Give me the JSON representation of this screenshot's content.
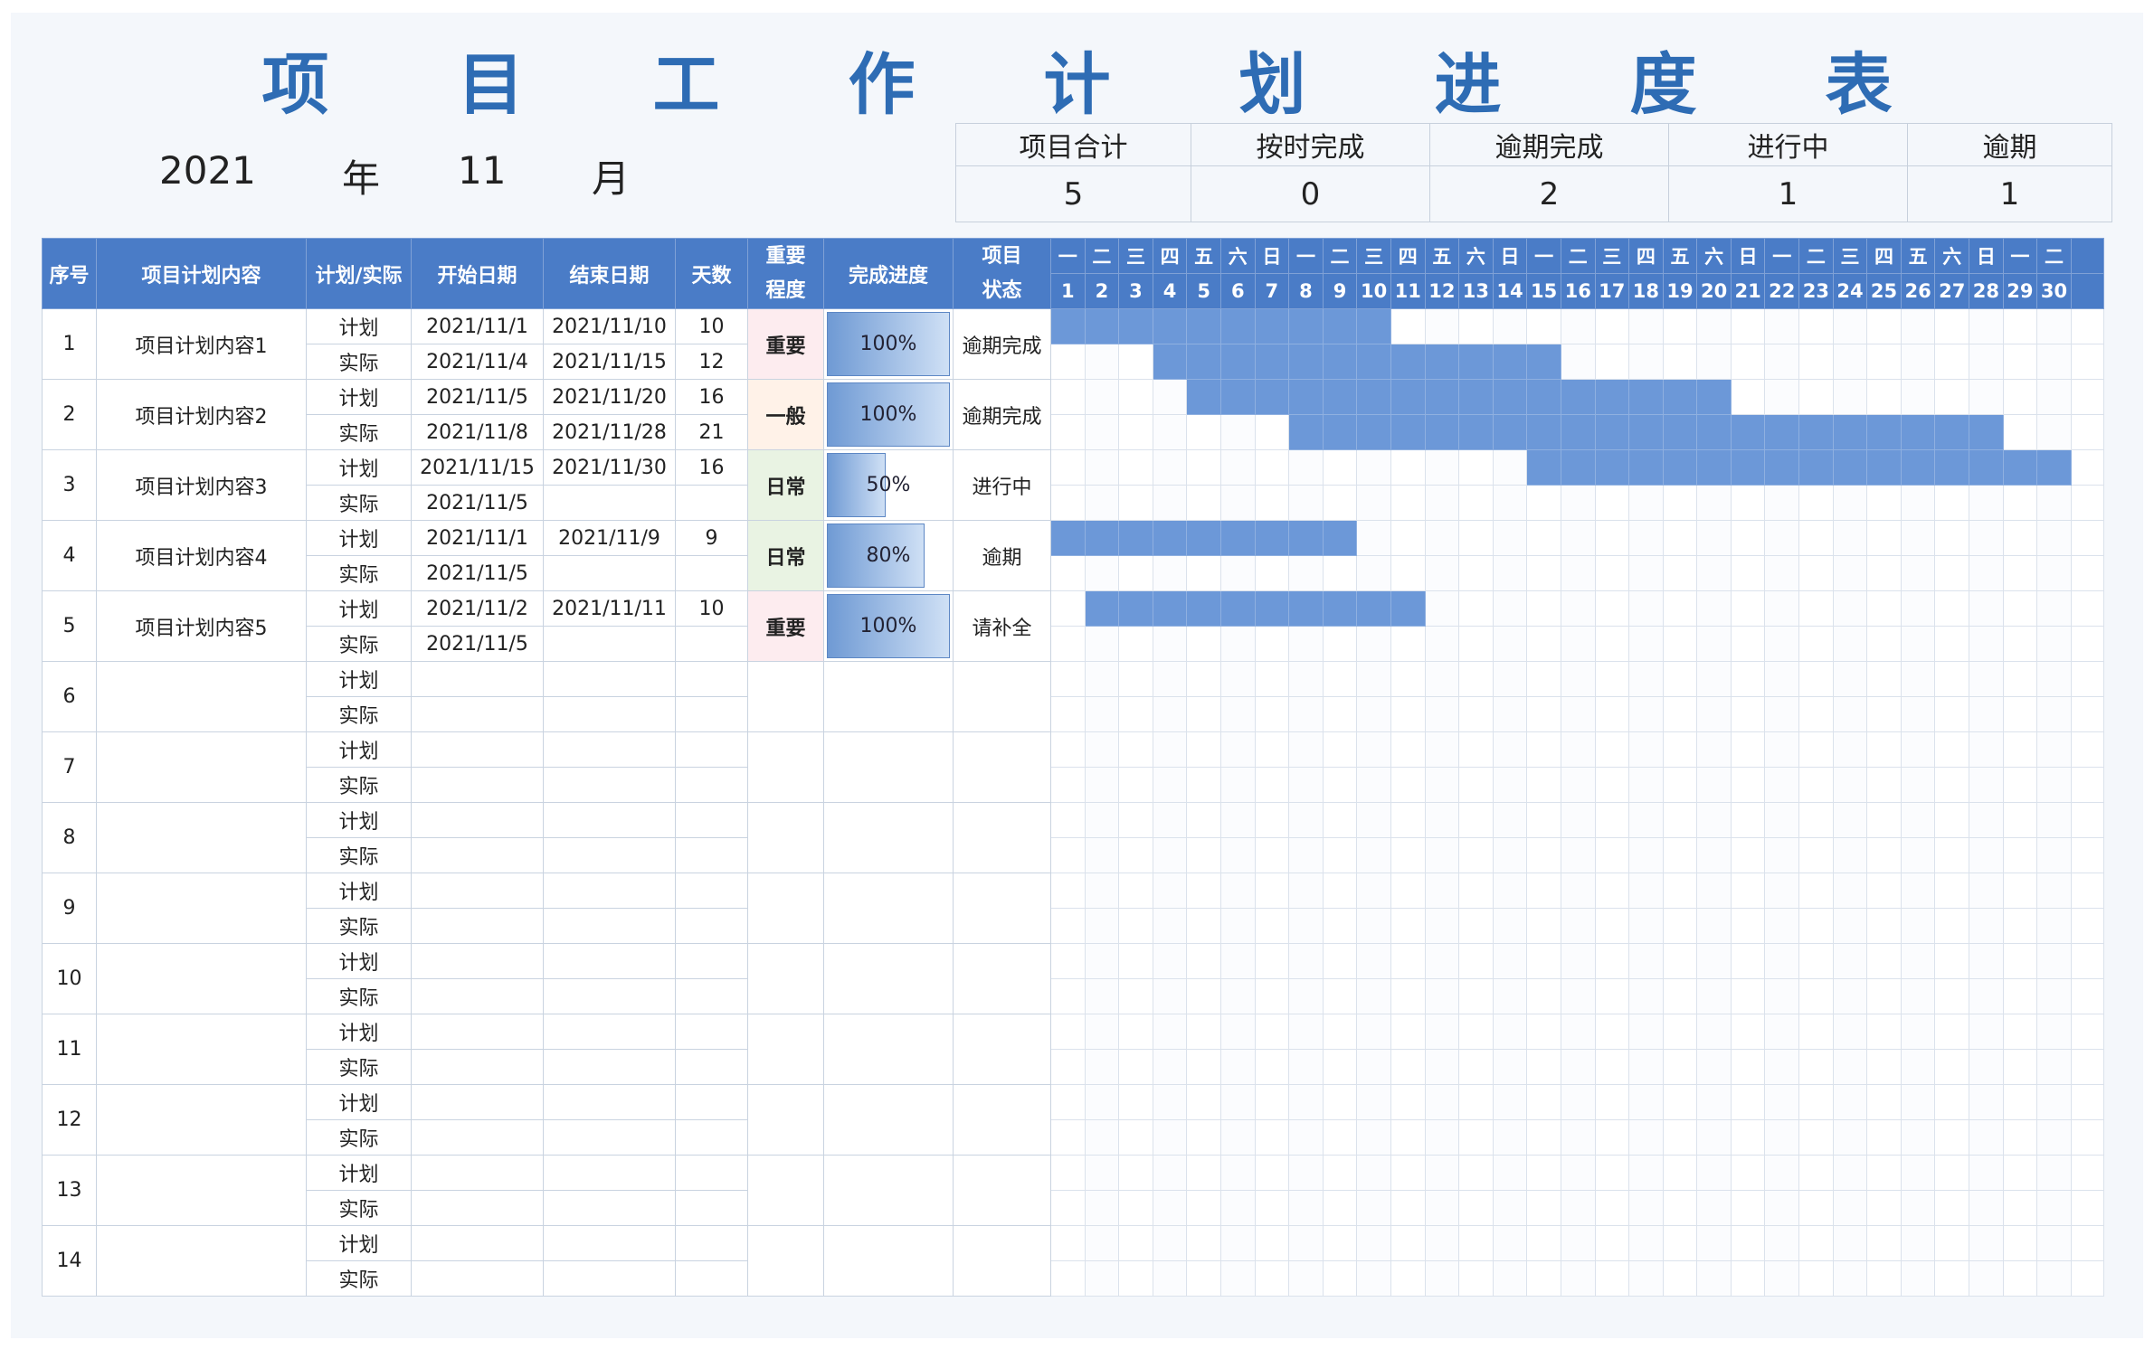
{
  "title_chars": [
    "项",
    "目",
    "工",
    "作",
    "计",
    "划",
    "进",
    "度",
    "表"
  ],
  "period": {
    "year": "2021",
    "year_unit": "年",
    "month": "11",
    "month_unit": "月"
  },
  "summary": {
    "headers": [
      "项目合计",
      "按时完成",
      "逾期完成",
      "进行中",
      "逾期"
    ],
    "values": [
      "5",
      "0",
      "2",
      "1",
      "1"
    ]
  },
  "columns": {
    "seq": "序号",
    "name": "项目计划内容",
    "type": "计划/实际",
    "start": "开始日期",
    "end": "结束日期",
    "days": "天数",
    "priority": "重要程度",
    "progress": "完成进度",
    "status": "项目状态"
  },
  "weekdays": [
    "一",
    "二",
    "三",
    "四",
    "五",
    "六",
    "日",
    "一",
    "二",
    "三",
    "四",
    "五",
    "六",
    "日",
    "一",
    "二",
    "三",
    "四",
    "五",
    "六",
    "日",
    "一",
    "二",
    "三",
    "四",
    "五",
    "六",
    "日",
    "一",
    "二"
  ],
  "days": [
    "1",
    "2",
    "3",
    "4",
    "5",
    "6",
    "7",
    "8",
    "9",
    "10",
    "11",
    "12",
    "13",
    "14",
    "15",
    "16",
    "17",
    "18",
    "19",
    "20",
    "21",
    "22",
    "23",
    "24",
    "25",
    "26",
    "27",
    "28",
    "29",
    "30"
  ],
  "type_labels": {
    "plan": "计划",
    "actual": "实际"
  },
  "colors": {
    "header": "#4a7cc7",
    "bar": "#6c98d8",
    "title": "#2e6cb4",
    "red": "#d9232f",
    "orange": "#e2731b",
    "green": "#3f8a2b"
  },
  "projects": [
    {
      "seq": "1",
      "name": "项目计划内容1",
      "priority": "重要",
      "priority_color": "red",
      "progress": "100%",
      "progress_value": 1.0,
      "status": "逾期完成",
      "plan": {
        "start": "2021/11/1",
        "end": "2021/11/10",
        "days": "10",
        "bar_from": 1,
        "bar_to": 10
      },
      "actual": {
        "start": "2021/11/4",
        "end": "2021/11/15",
        "days": "12",
        "bar_from": 4,
        "bar_to": 15
      }
    },
    {
      "seq": "2",
      "name": "项目计划内容2",
      "priority": "一般",
      "priority_color": "orange",
      "progress": "100%",
      "progress_value": 1.0,
      "status": "逾期完成",
      "plan": {
        "start": "2021/11/5",
        "end": "2021/11/20",
        "days": "16",
        "bar_from": 5,
        "bar_to": 20
      },
      "actual": {
        "start": "2021/11/8",
        "end": "2021/11/28",
        "days": "21",
        "bar_from": 8,
        "bar_to": 28
      }
    },
    {
      "seq": "3",
      "name": "项目计划内容3",
      "priority": "日常",
      "priority_color": "green",
      "progress": "50%",
      "progress_value": 0.5,
      "status": "进行中",
      "plan": {
        "start": "2021/11/15",
        "end": "2021/11/30",
        "days": "16",
        "bar_from": 15,
        "bar_to": 30
      },
      "actual": {
        "start": "2021/11/5",
        "end": "",
        "days": "",
        "bar_from": 0,
        "bar_to": 0
      }
    },
    {
      "seq": "4",
      "name": "项目计划内容4",
      "priority": "日常",
      "priority_color": "green",
      "progress": "80%",
      "progress_value": 0.8,
      "status": "逾期",
      "plan": {
        "start": "2021/11/1",
        "end": "2021/11/9",
        "days": "9",
        "bar_from": 1,
        "bar_to": 9
      },
      "actual": {
        "start": "2021/11/5",
        "end": "",
        "days": "",
        "bar_from": 0,
        "bar_to": 0
      }
    },
    {
      "seq": "5",
      "name": "项目计划内容5",
      "priority": "重要",
      "priority_color": "red",
      "progress": "100%",
      "progress_value": 1.0,
      "status": "请补全",
      "plan": {
        "start": "2021/11/2",
        "end": "2021/11/11",
        "days": "10",
        "bar_from": 2,
        "bar_to": 11
      },
      "actual": {
        "start": "2021/11/5",
        "end": "",
        "days": "",
        "bar_from": 0,
        "bar_to": 0
      }
    }
  ],
  "empty_rows": [
    "6",
    "7",
    "8",
    "9",
    "10",
    "11",
    "12",
    "13",
    "14"
  ]
}
